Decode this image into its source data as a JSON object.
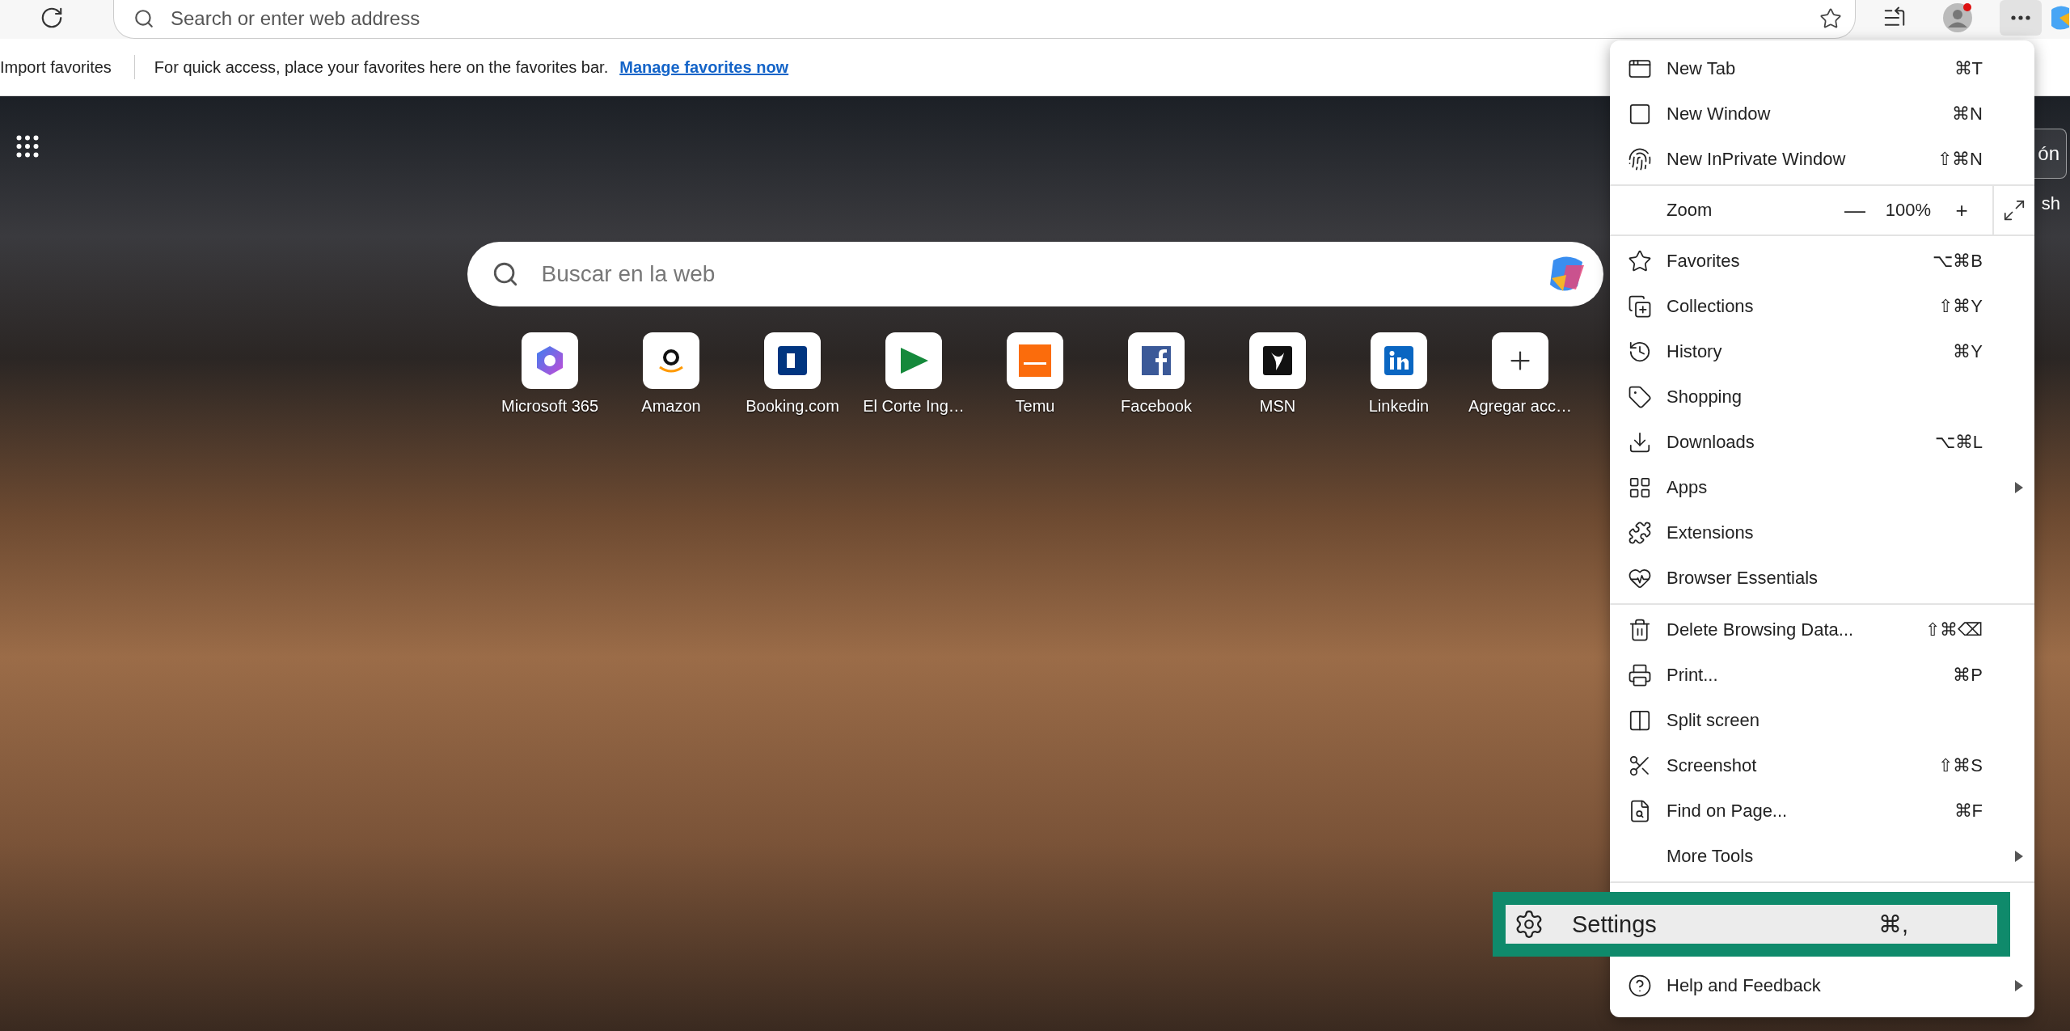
{
  "toolbar": {
    "address_placeholder": "Search or enter web address"
  },
  "favorites_bar": {
    "import_label": "Import favorites",
    "message": "For quick access, place your favorites here on the favorites bar.",
    "link": "Manage favorites now"
  },
  "page": {
    "search_placeholder": "Buscar en la web",
    "corner_button": "ón",
    "corner_text": "sh",
    "shortcuts": [
      {
        "label": "Microsoft 365"
      },
      {
        "label": "Amazon"
      },
      {
        "label": "Booking.com"
      },
      {
        "label": "El Corte Ing…"
      },
      {
        "label": "Temu"
      },
      {
        "label": "Facebook"
      },
      {
        "label": "MSN"
      },
      {
        "label": "Linkedin"
      },
      {
        "label": "Agregar acc…"
      }
    ]
  },
  "menu": {
    "sections": [
      [
        {
          "kind": "item",
          "label": "New Tab",
          "shortcut": "⌘T",
          "submenu": false,
          "highlighted": false
        },
        {
          "kind": "item",
          "label": "New Window",
          "shortcut": "⌘N",
          "submenu": false,
          "highlighted": false
        },
        {
          "kind": "item",
          "label": "New InPrivate Window",
          "shortcut": "⇧⌘N",
          "submenu": false,
          "highlighted": false
        }
      ],
      [
        {
          "kind": "zoom",
          "label": "Zoom",
          "minus": "—",
          "value": "100%",
          "plus": "+"
        }
      ],
      [
        {
          "kind": "item",
          "label": "Favorites",
          "shortcut": "⌥⌘B",
          "submenu": false,
          "highlighted": false
        },
        {
          "kind": "item",
          "label": "Collections",
          "shortcut": "⇧⌘Y",
          "submenu": false,
          "highlighted": false
        },
        {
          "kind": "item",
          "label": "History",
          "shortcut": "⌘Y",
          "submenu": false,
          "highlighted": false
        },
        {
          "kind": "item",
          "label": "Shopping",
          "submenu": false,
          "highlighted": false
        },
        {
          "kind": "item",
          "label": "Downloads",
          "shortcut": "⌥⌘L",
          "submenu": false,
          "highlighted": false
        },
        {
          "kind": "item",
          "label": "Apps",
          "submenu": true,
          "highlighted": false
        },
        {
          "kind": "item",
          "label": "Extensions",
          "submenu": false,
          "highlighted": false
        },
        {
          "kind": "item",
          "label": "Browser Essentials",
          "submenu": false,
          "highlighted": false
        }
      ],
      [
        {
          "kind": "item",
          "label": "Delete Browsing Data...",
          "shortcut": "⇧⌘⌫",
          "submenu": false,
          "highlighted": false
        },
        {
          "kind": "item",
          "label": "Print...",
          "shortcut": "⌘P",
          "submenu": false,
          "highlighted": false
        },
        {
          "kind": "item",
          "label": "Split screen",
          "submenu": false,
          "highlighted": false
        },
        {
          "kind": "item",
          "label": "Screenshot",
          "shortcut": "⇧⌘S",
          "submenu": false,
          "highlighted": false
        },
        {
          "kind": "item",
          "label": "Find on Page...",
          "shortcut": "⌘F",
          "submenu": false,
          "highlighted": false
        },
        {
          "kind": "item",
          "label": "More Tools",
          "submenu": true,
          "highlighted": false
        }
      ],
      [
        {
          "kind": "item",
          "label": "Settings",
          "shortcut": "⌘,",
          "submenu": false,
          "highlighted": true
        },
        {
          "kind": "item",
          "label": "Help and Feedback",
          "submenu": true,
          "highlighted": false
        }
      ]
    ]
  }
}
